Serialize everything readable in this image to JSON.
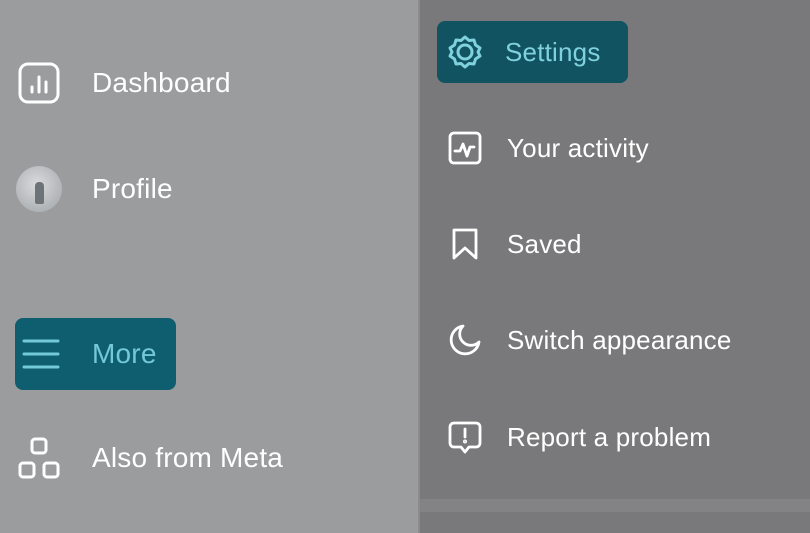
{
  "left_menu": {
    "items": [
      {
        "id": "dashboard",
        "label": "Dashboard",
        "icon": "bar-chart-icon"
      },
      {
        "id": "profile",
        "label": "Profile",
        "icon": "avatar"
      },
      {
        "id": "more",
        "label": "More",
        "icon": "hamburger-menu-icon",
        "active": true
      },
      {
        "id": "also-meta",
        "label": "Also from Meta",
        "icon": "apps-grid-icon"
      }
    ]
  },
  "more_menu": {
    "items": [
      {
        "id": "settings",
        "label": "Settings",
        "icon": "settings-gear-icon",
        "active": true
      },
      {
        "id": "activity",
        "label": "Your activity",
        "icon": "activity-icon"
      },
      {
        "id": "saved",
        "label": "Saved",
        "icon": "bookmark-icon"
      },
      {
        "id": "appearance",
        "label": "Switch appearance",
        "icon": "moon-icon"
      },
      {
        "id": "report",
        "label": "Report a problem",
        "icon": "report-problem-icon"
      }
    ]
  },
  "colors": {
    "left_background": "#9b9c9e",
    "right_background": "#79797b",
    "active_more_bg": "#0e5e6f",
    "active_more_text": "#74c9d7",
    "active_settings_bg": "#125361",
    "active_settings_text": "#7fd1de"
  }
}
